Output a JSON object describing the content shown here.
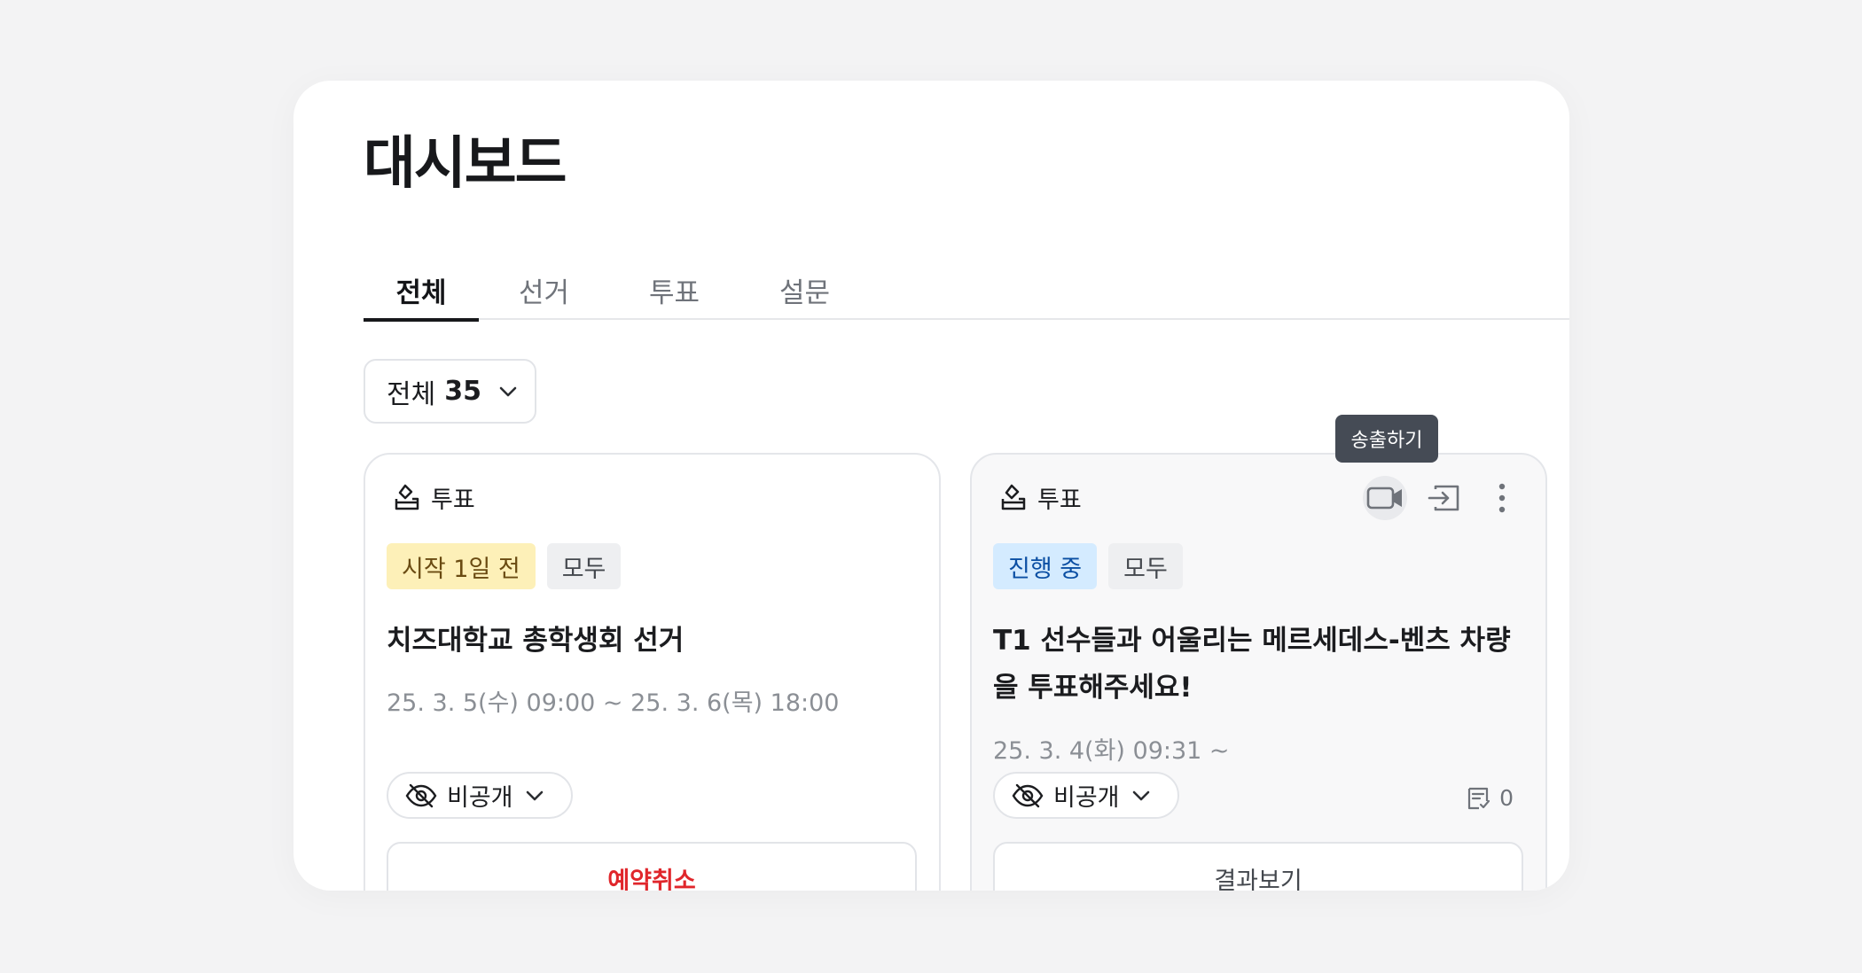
{
  "page": {
    "title": "대시보드"
  },
  "tabs": [
    {
      "label": "전체",
      "active": true
    },
    {
      "label": "선거"
    },
    {
      "label": "투표"
    },
    {
      "label": "설문"
    }
  ],
  "filter": {
    "label": "전체",
    "count": "35"
  },
  "tooltip": "송출하기",
  "cards": [
    {
      "type_label": "투표",
      "badges": [
        "시작 1일 전",
        "모두"
      ],
      "title": "치즈대학교 총학생회 선거",
      "date": "25. 3. 5(수) 09:00 ~ 25. 3. 6(목) 18:00",
      "visibility": "비공개",
      "action": "예약취소"
    },
    {
      "type_label": "투표",
      "badges": [
        "진행 중",
        "모두"
      ],
      "title": "T1 선수들과 어울리는 메르세데스-벤츠 차량을 투표해주세요!",
      "date": "25. 3. 4(화) 09:31 ~",
      "visibility": "비공개",
      "comment_count": "0",
      "action": "결과보기"
    }
  ],
  "colors": {
    "background": "#f3f3f4",
    "yellow_badge": "#fdf0b8",
    "blue_badge": "#d4ebff",
    "cancel_text": "#e0262b",
    "tooltip": "#454b55"
  }
}
